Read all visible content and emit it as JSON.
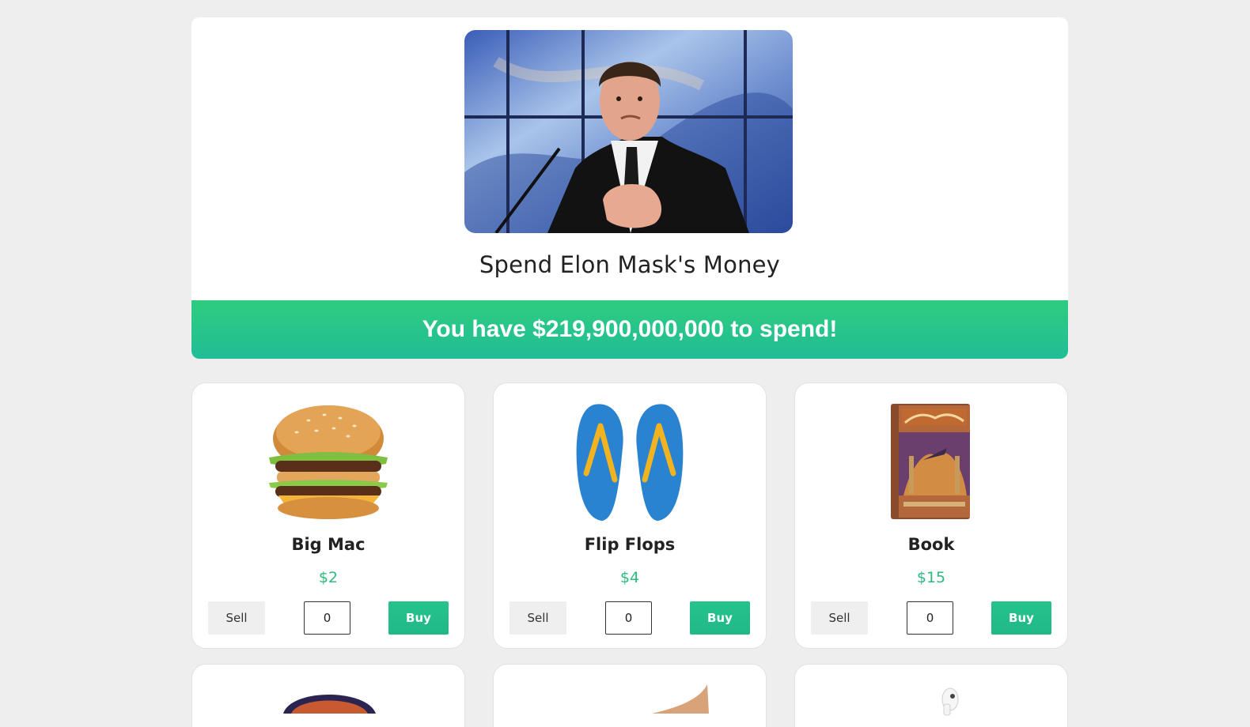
{
  "header": {
    "title": "Spend Elon Mask's Money",
    "balance_text": "You have $219,900,000,000 to spend!"
  },
  "products": [
    {
      "name": "Big Mac",
      "price": "$2",
      "sell_label": "Sell",
      "buy_label": "Buy",
      "quantity": "0"
    },
    {
      "name": "Flip Flops",
      "price": "$4",
      "sell_label": "Sell",
      "buy_label": "Buy",
      "quantity": "0"
    },
    {
      "name": "Book",
      "price": "$15",
      "sell_label": "Sell",
      "buy_label": "Buy",
      "quantity": "0"
    }
  ],
  "colors": {
    "accent": "#21bd8a",
    "price": "#2dba7e",
    "background": "#eeeeee"
  }
}
